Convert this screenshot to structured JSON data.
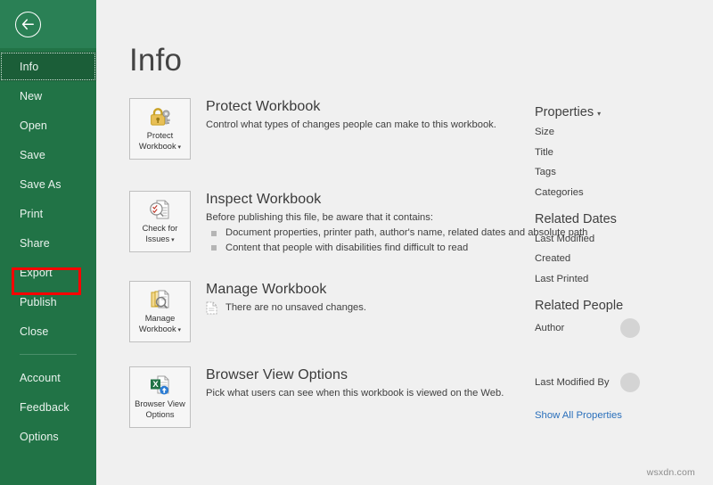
{
  "sidebar": {
    "back_icon": "back-arrow-icon",
    "items": [
      {
        "label": "Info",
        "selected": true,
        "divider_before": false
      },
      {
        "label": "New",
        "selected": false,
        "divider_before": false
      },
      {
        "label": "Open",
        "selected": false,
        "divider_before": false
      },
      {
        "label": "Save",
        "selected": false,
        "divider_before": false
      },
      {
        "label": "Save As",
        "selected": false,
        "divider_before": false
      },
      {
        "label": "Print",
        "selected": false,
        "divider_before": false
      },
      {
        "label": "Share",
        "selected": false,
        "divider_before": false
      },
      {
        "label": "Export",
        "selected": false,
        "divider_before": false,
        "highlighted": true
      },
      {
        "label": "Publish",
        "selected": false,
        "divider_before": false
      },
      {
        "label": "Close",
        "selected": false,
        "divider_before": false
      },
      {
        "label": "Account",
        "selected": false,
        "divider_before": true
      },
      {
        "label": "Feedback",
        "selected": false,
        "divider_before": false
      },
      {
        "label": "Options",
        "selected": false,
        "divider_before": false
      }
    ],
    "highlight_color": "#ff0000",
    "background_color": "#217346"
  },
  "main": {
    "title": "Info",
    "sections": [
      {
        "tile_label_line1": "Protect",
        "tile_label_line2": "Workbook",
        "tile_has_caret": true,
        "tile_icon": "lock-and-key-icon",
        "heading": "Protect Workbook",
        "description": "Control what types of changes people can make to this workbook."
      },
      {
        "tile_label_line1": "Check for",
        "tile_label_line2": "Issues",
        "tile_has_caret": true,
        "tile_icon": "document-magnifier-icon",
        "heading": "Inspect Workbook",
        "description": "Before publishing this file, be aware that it contains:",
        "bullets": [
          "Document properties, printer path, author's name, related dates and absolute path",
          "Content that people with disabilities find difficult to read"
        ]
      },
      {
        "tile_label_line1": "Manage",
        "tile_label_line2": "Workbook",
        "tile_has_caret": true,
        "tile_icon": "stacked-documents-magnifier-icon",
        "heading": "Manage Workbook",
        "note_icon": "unsaved-document-icon",
        "note": "There are no unsaved changes."
      },
      {
        "tile_label_line1": "Browser View",
        "tile_label_line2": "Options",
        "tile_has_caret": false,
        "tile_icon": "excel-upload-icon",
        "heading": "Browser View Options",
        "description": "Pick what users can see when this workbook is viewed on the Web."
      }
    ]
  },
  "properties_panel": {
    "groups": [
      {
        "heading": "Properties",
        "has_caret": true,
        "rows": [
          {
            "label": "Size",
            "value": ""
          },
          {
            "label": "Title",
            "value": ""
          },
          {
            "label": "Tags",
            "value": ""
          },
          {
            "label": "Categories",
            "value": ""
          }
        ]
      },
      {
        "heading": "Related Dates",
        "has_caret": false,
        "rows": [
          {
            "label": "Last Modified",
            "value": ""
          },
          {
            "label": "Created",
            "value": ""
          },
          {
            "label": "Last Printed",
            "value": ""
          }
        ]
      }
    ],
    "people_heading": "Related People",
    "people": [
      {
        "label": "Author"
      },
      {
        "label": "Last Modified By"
      }
    ],
    "show_all_properties": "Show All Properties",
    "link_color": "#2a6fbb"
  },
  "watermark": "wsxdn.com"
}
